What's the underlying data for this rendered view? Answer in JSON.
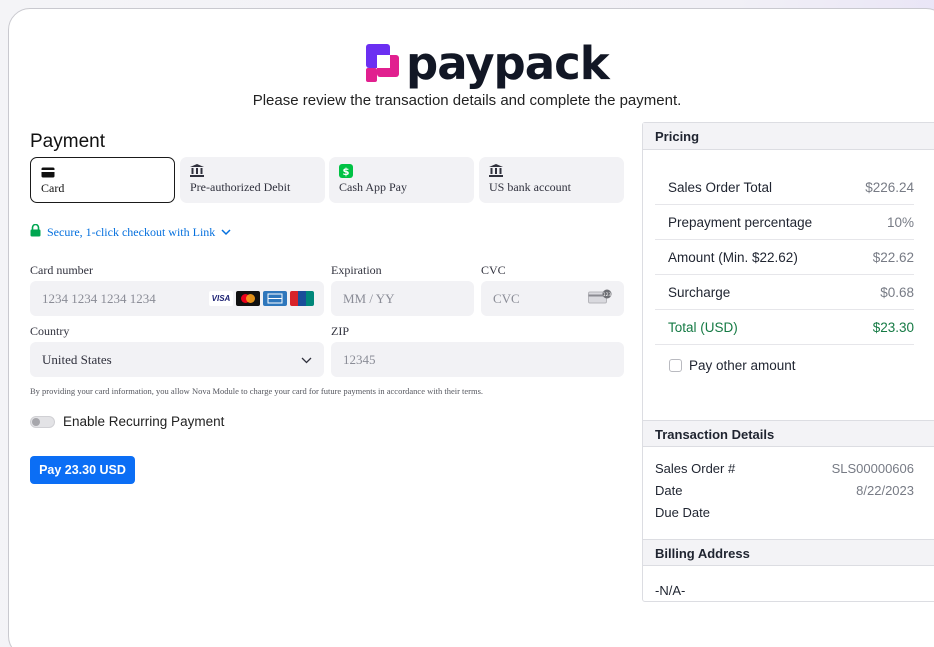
{
  "brand": {
    "name": "paypack"
  },
  "subtitle": "Please review the transaction details and complete the payment.",
  "payment": {
    "title": "Payment",
    "tabs": [
      {
        "label": "Card",
        "icon": "card-icon",
        "active": true
      },
      {
        "label": "Pre-authorized Debit",
        "icon": "bank-icon",
        "active": false
      },
      {
        "label": "Cash App Pay",
        "icon": "cash-app-icon",
        "active": false
      },
      {
        "label": "US bank account",
        "icon": "bank-icon",
        "active": false
      }
    ],
    "link_checkout": "Secure, 1-click checkout with Link",
    "card_number": {
      "label": "Card number",
      "placeholder": "1234 1234 1234 1234"
    },
    "expiration": {
      "label": "Expiration",
      "placeholder": "MM / YY"
    },
    "cvc": {
      "label": "CVC",
      "placeholder": "CVC"
    },
    "country": {
      "label": "Country",
      "value": "United States"
    },
    "zip": {
      "label": "ZIP",
      "placeholder": "12345"
    },
    "terms": "By providing your card information, you allow Nova Module to charge your card for future payments in accordance with their terms.",
    "recurring_label": "Enable Recurring Payment",
    "pay_button": "Pay 23.30 USD"
  },
  "pricing": {
    "title": "Pricing",
    "rows": [
      {
        "label": "Sales Order Total",
        "value": "$226.24"
      },
      {
        "label": "Prepayment percentage",
        "value": "10%"
      },
      {
        "label": "Amount (Min. $22.62)",
        "value": "$22.62"
      },
      {
        "label": "Surcharge",
        "value": "$0.68"
      },
      {
        "label": "Total (USD)",
        "value": "$23.30"
      }
    ],
    "pay_other": "Pay other amount"
  },
  "transaction": {
    "title": "Transaction Details",
    "rows": [
      {
        "label": "Sales Order #",
        "value": "SLS00000606"
      },
      {
        "label": "Date",
        "value": "8/22/2023"
      },
      {
        "label": "Due Date",
        "value": ""
      }
    ]
  },
  "billing": {
    "title": "Billing Address",
    "value": "-N/A-"
  },
  "colors": {
    "accent": "#0b6ef5",
    "link": "#0570de",
    "total_green": "#157a44",
    "brand_pink": "#e1208f",
    "brand_purple": "#6b2ff2"
  }
}
